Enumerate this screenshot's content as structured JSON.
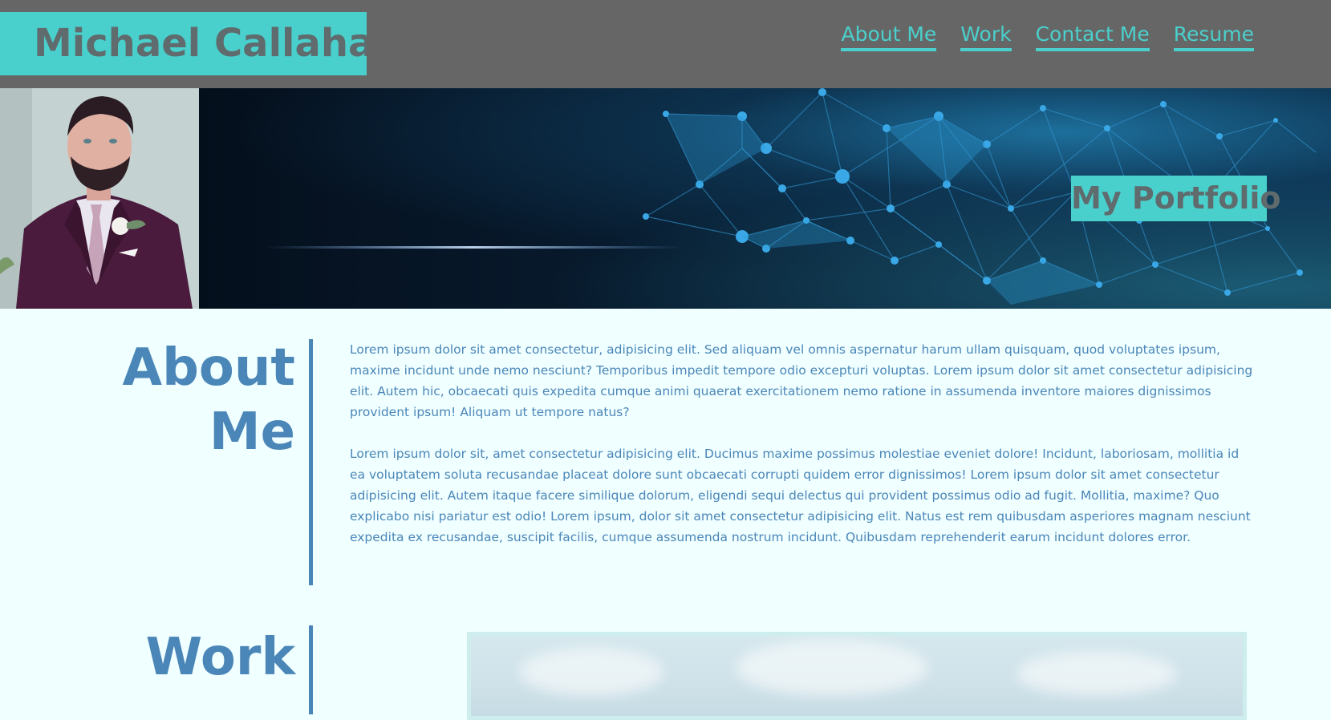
{
  "header": {
    "brand": "Michael Callahan",
    "nav": [
      "About Me",
      "Work",
      "Contact Me",
      "Resume"
    ]
  },
  "hero": {
    "portrait_alt": "portrait-photo",
    "tag": "My Portfolio"
  },
  "about": {
    "heading_line1": "About",
    "heading_line2": "Me",
    "paragraphs": [
      "Lorem ipsum dolor sit amet consectetur, adipisicing elit. Sed aliquam vel omnis aspernatur harum ullam quisquam, quod voluptates ipsum, maxime incidunt unde nemo nesciunt? Temporibus impedit tempore odio excepturi voluptas. Lorem ipsum dolor sit amet consectetur adipisicing elit. Autem hic, obcaecati quis expedita cumque animi quaerat exercitationem nemo ratione in assumenda inventore maiores dignissimos provident ipsum! Aliquam ut tempore natus?",
      "Lorem ipsum dolor sit, amet consectetur adipisicing elit. Ducimus maxime possimus molestiae eveniet dolore! Incidunt, laboriosam, mollitia id ea voluptatem soluta recusandae placeat dolore sunt obcaecati corrupti quidem error dignissimos! Lorem ipsum dolor sit amet consectetur adipisicing elit. Autem itaque facere similique dolorum, eligendi sequi delectus qui provident possimus odio ad fugit. Mollitia, maxime? Quo explicabo nisi pariatur est odio! Lorem ipsum, dolor sit amet consectetur adipisicing elit. Natus est rem quibusdam asperiores magnam nesciunt expedita ex recusandae, suscipit facilis, cumque assumenda nostrum incidunt. Quibusdam reprehenderit earum incidunt dolores error."
    ]
  },
  "work": {
    "heading": "Work"
  },
  "colors": {
    "header_bg": "#666666",
    "accent": "#4ad0cc",
    "text_blue": "#4b86b8",
    "page_bg": "#f0ffff"
  }
}
